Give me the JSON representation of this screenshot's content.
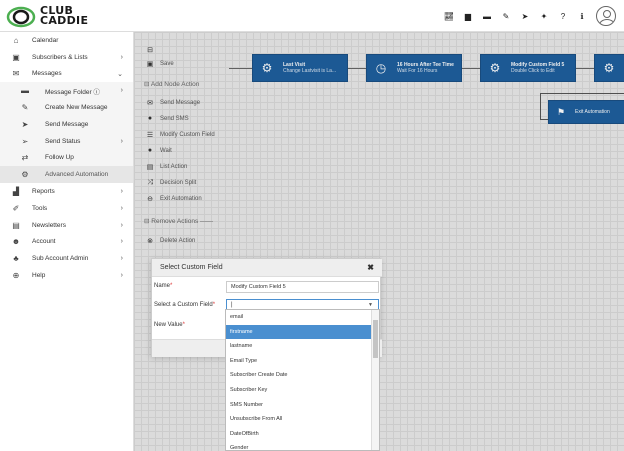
{
  "app": {
    "logo_line1": "CLUB",
    "logo_line2": "CADDIE",
    "top_icons": [
      "chart-icon",
      "document-icon",
      "folder-icon",
      "edit-icon",
      "send-icon",
      "users-icon",
      "help-icon",
      "info-icon"
    ]
  },
  "sidebar": {
    "items": [
      {
        "label": "Calendar",
        "icon": "home-icon",
        "chevron": ""
      },
      {
        "label": "Subscribers & Lists",
        "icon": "id-card-icon",
        "chevron": "›"
      },
      {
        "label": "Messages",
        "icon": "envelope-icon",
        "chevron": "⌄"
      },
      {
        "label": "Message Folder ⓘ",
        "icon": "folder-icon",
        "chevron": "›"
      },
      {
        "label": "Create New Message",
        "icon": "pencil-icon",
        "chevron": ""
      },
      {
        "label": "Send Message",
        "icon": "send-icon",
        "chevron": ""
      },
      {
        "label": "Send Status",
        "icon": "send-outline-icon",
        "chevron": "›"
      },
      {
        "label": "Follow Up",
        "icon": "follow-up-icon",
        "chevron": ""
      },
      {
        "label": "Advanced Automation",
        "icon": "gear-icon",
        "chevron": ""
      },
      {
        "label": "Reports",
        "icon": "bar-chart-icon",
        "chevron": "›"
      },
      {
        "label": "Tools",
        "icon": "wrench-icon",
        "chevron": "›"
      },
      {
        "label": "Newsletters",
        "icon": "newspaper-icon",
        "chevron": "›"
      },
      {
        "label": "Account",
        "icon": "user-plus-icon",
        "chevron": "›"
      },
      {
        "label": "Sub Account Admin",
        "icon": "sitemap-icon",
        "chevron": "›"
      },
      {
        "label": "Help",
        "icon": "lifebuoy-icon",
        "chevron": "›"
      }
    ]
  },
  "palette": {
    "save": "Save",
    "add_node_header": "Add Node Action",
    "items": [
      "Send Message",
      "Send SMS",
      "Modify Custom Field",
      "Wait",
      "List Action",
      "Decision Split",
      "Exit Automation"
    ],
    "remove_header": "Remove Actions",
    "delete": "Delete Action"
  },
  "flow": {
    "nodes": [
      {
        "title": "Last Visit",
        "sub": "Change Lastvisit is La..."
      },
      {
        "title": "16 Hours After Tee Time",
        "sub": "Wait For 16 Hours"
      },
      {
        "title": "Modify Custom Field 5",
        "sub": "Double Click to Edit"
      }
    ],
    "exit_label": "Exit Automation"
  },
  "modal": {
    "title": "Select Custom Field",
    "name_label": "Name",
    "name_value": "Modify Custom Field 5",
    "field_label": "Select a Custom Field",
    "field_value": "|",
    "new_value_label": "New Value",
    "required_mark": "*"
  },
  "dropdown": {
    "options": [
      "email",
      "firstname",
      "lastname",
      "Email Type",
      "Subscriber Create Date",
      "Subscriber Key",
      "SMS Number",
      "Unsubscribe From All",
      "DateOfBirth",
      "Gender"
    ],
    "highlighted": "firstname"
  },
  "colors": {
    "accent": "#1e5f9e",
    "highlight": "#4a8fd0",
    "logo_green": "#4caf50"
  }
}
